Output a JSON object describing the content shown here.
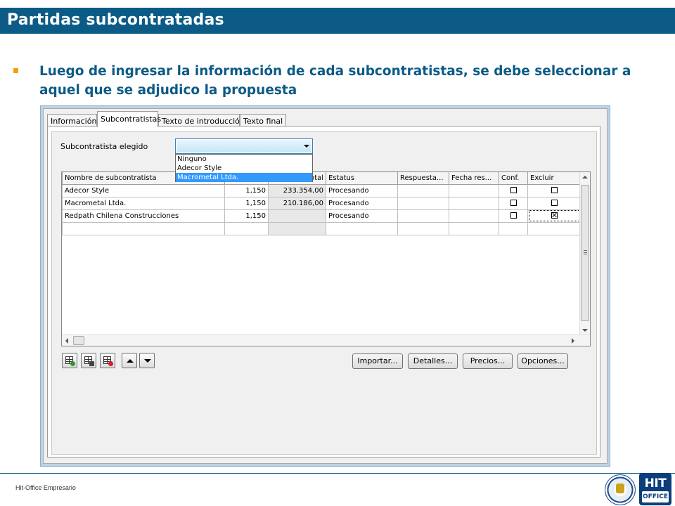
{
  "slide": {
    "title": "Partidas subcontratadas",
    "bullet": "Luego de ingresar la información de cada subcontratistas, se debe seleccionar a aquel que se adjudico la propuesta",
    "footer": "Hit-Office Empresario",
    "logo_text_top": "HIT",
    "logo_text_bottom": "OFFICE",
    "colors": {
      "header_bg": "#0b5b86",
      "bullet_text": "#0b5b86",
      "bullet_mark": "#f0a300"
    }
  },
  "app": {
    "tabs": [
      {
        "label": "Información",
        "active": false
      },
      {
        "label": "Subcontratistas",
        "active": true
      },
      {
        "label": "Texto de introducción",
        "active": false
      },
      {
        "label": "Texto final",
        "active": false
      }
    ],
    "subcontratista_label": "Subcontratista elegido",
    "combo_value": "",
    "dropdown_options": [
      {
        "label": "Ninguno",
        "selected": false
      },
      {
        "label": "Adecor Style",
        "selected": false
      },
      {
        "label": "Macrometal Ltda.",
        "selected": true
      }
    ],
    "grid": {
      "columns": [
        "Nombre de subcontratista",
        "",
        "otal",
        "Estatus",
        "Respuesta...",
        "Fecha res...",
        "Conf.",
        "Excluir"
      ],
      "rows": [
        {
          "name": "Adecor Style",
          "factor": "1,150",
          "total": "233.354,00",
          "status": "Procesando",
          "respuesta": "",
          "fecha": "",
          "conf": false,
          "excluir": false
        },
        {
          "name": "Macrometal Ltda.",
          "factor": "1,150",
          "total": "210.186,00",
          "status": "Procesando",
          "respuesta": "",
          "fecha": "",
          "conf": false,
          "excluir": false
        },
        {
          "name": "Redpath Chilena Construcciones",
          "factor": "1,150",
          "total": "",
          "status": "Procesando",
          "respuesta": "",
          "fecha": "",
          "conf": false,
          "excluir": true
        }
      ]
    },
    "buttons": {
      "importar": "Importar...",
      "detalles": "Detalles...",
      "precios": "Precios...",
      "opciones": "Opciones..."
    },
    "toolbar_icons": [
      "add-row-icon",
      "copy-row-icon",
      "delete-row-icon",
      "move-up-icon",
      "move-down-icon"
    ]
  }
}
